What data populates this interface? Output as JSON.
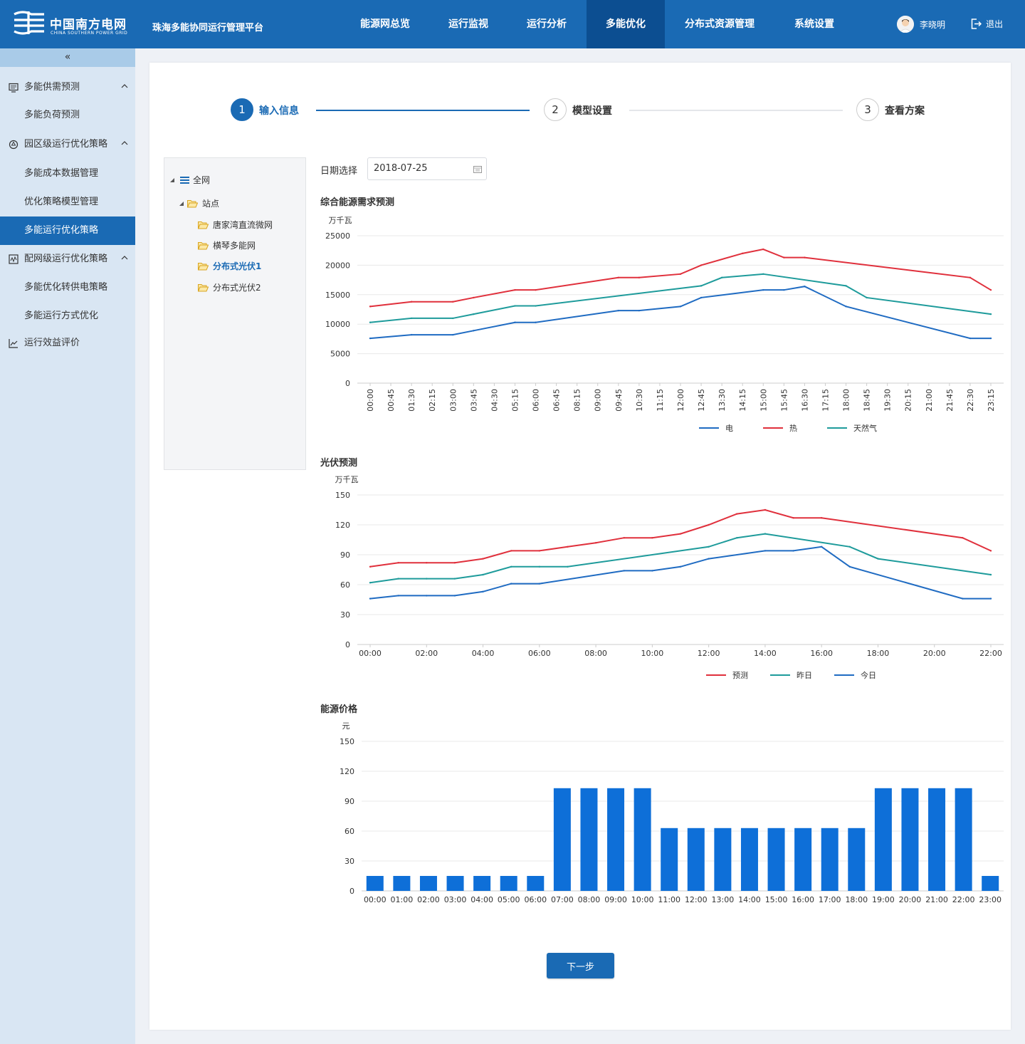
{
  "header": {
    "logo_cn": "中国南方电网",
    "logo_en": "CHINA SOUTHERN POWER GRID",
    "platform": "珠海多能协同运行管理平台",
    "nav": [
      "能源网总览",
      "运行监视",
      "运行分析",
      "多能优化",
      "分布式资源管理",
      "系统设置"
    ],
    "active_nav": "多能优化",
    "user_name": "李晓明",
    "logout": "退出"
  },
  "sidebar": {
    "collapse_icon": "«",
    "groups": [
      {
        "label": "多能供需预测",
        "icon": "monitor-icon",
        "expanded": true,
        "items": [
          "多能负荷预测"
        ]
      },
      {
        "label": "园区级运行优化策略",
        "icon": "recycle-icon",
        "expanded": true,
        "items": [
          "多能成本数据管理",
          "优化策略模型管理",
          "多能运行优化策略"
        ]
      },
      {
        "label": "配网级运行优化策略",
        "icon": "pulse-icon",
        "expanded": true,
        "items": [
          "多能优化转供电策略",
          "多能运行方式优化"
        ]
      },
      {
        "label": "运行效益评价",
        "icon": "line-chart-icon",
        "expanded": false,
        "items": []
      }
    ],
    "active_item": "多能运行优化策略"
  },
  "steps": [
    {
      "num": "1",
      "label": "输入信息",
      "status": "active"
    },
    {
      "num": "2",
      "label": "模型设置",
      "status": "todo"
    },
    {
      "num": "3",
      "label": "查看方案",
      "status": "todo"
    }
  ],
  "tree": {
    "root": "全网",
    "folder": "站点",
    "children": [
      "唐家湾直流微网",
      "横琴多能网",
      "分布式光伏1",
      "分布式光伏2"
    ],
    "selected": "分布式光伏1"
  },
  "date": {
    "label": "日期选择",
    "value": "2018-07-25"
  },
  "colors": {
    "primary": "#1a6ab4",
    "electric": "#1f6bc2",
    "heat": "#e0303c",
    "gas": "#1e9b9b",
    "bar": "#0e6fd8"
  },
  "chart_data": [
    {
      "type": "line",
      "title": "综合能源需求预测",
      "ylabel": "万千瓦",
      "ylim": [
        0,
        25000
      ],
      "yticks": [
        0,
        5000,
        10000,
        15000,
        20000,
        25000
      ],
      "x": [
        "00:00",
        "00:45",
        "01:30",
        "02:15",
        "03:00",
        "03:45",
        "04:30",
        "05:15",
        "06:00",
        "06:45",
        "08:15",
        "09:00",
        "09:45",
        "10:30",
        "11:15",
        "12:00",
        "12:45",
        "13:30",
        "14:15",
        "15:00",
        "15:45",
        "16:30",
        "17:15",
        "18:00",
        "18:45",
        "19:30",
        "20:15",
        "21:00",
        "21:45",
        "22:30",
        "23:15"
      ],
      "series": [
        {
          "name": "电",
          "color": "#1f6bc2",
          "values": [
            7600,
            null,
            8200,
            null,
            8200,
            8900,
            null,
            10300,
            10300,
            null,
            null,
            null,
            12300,
            12300,
            null,
            13000,
            14500,
            null,
            null,
            15800,
            15800,
            16400,
            null,
            13000,
            null,
            null,
            null,
            null,
            null,
            7600,
            7600
          ]
        },
        {
          "name": "热",
          "color": "#e0303c",
          "values": [
            13000,
            null,
            13800,
            null,
            13800,
            14500,
            null,
            15800,
            15800,
            null,
            null,
            null,
            17900,
            17900,
            null,
            18500,
            20000,
            null,
            22000,
            22700,
            21300,
            21300,
            null,
            null,
            null,
            null,
            null,
            null,
            null,
            17900,
            15800
          ]
        },
        {
          "name": "天然气",
          "color": "#1e9b9b",
          "values": [
            10300,
            null,
            11000,
            null,
            11000,
            11700,
            null,
            13100,
            13100,
            null,
            null,
            null,
            null,
            null,
            null,
            null,
            16500,
            17900,
            null,
            18500,
            null,
            null,
            null,
            16500,
            14500,
            null,
            null,
            null,
            null,
            null,
            11700
          ]
        }
      ],
      "legend_position": "bottom"
    },
    {
      "type": "line",
      "title": "光伏预测",
      "ylabel": "万千瓦",
      "ylim": [
        0,
        150
      ],
      "yticks": [
        0,
        30,
        60,
        90,
        120,
        150
      ],
      "x": [
        "00:00",
        "01:00",
        "02:00",
        "03:00",
        "04:00",
        "05:00",
        "06:00",
        "07:00",
        "08:00",
        "09:00",
        "10:00",
        "11:00",
        "12:00",
        "13:00",
        "14:00",
        "15:00",
        "16:00",
        "17:00",
        "18:00",
        "19:00",
        "20:00",
        "21:00",
        "22:00"
      ],
      "xtick_labels": [
        "00:00",
        "02:00",
        "04:00",
        "06:00",
        "08:00",
        "10:00",
        "12:00",
        "14:00",
        "16:00",
        "18:00",
        "20:00",
        "22:00"
      ],
      "series": [
        {
          "name": "预测",
          "color": "#e0303c",
          "values": [
            78,
            82,
            82,
            82,
            86,
            94,
            94,
            98,
            102,
            107,
            107,
            111,
            120,
            131,
            135,
            127,
            127,
            null,
            null,
            null,
            null,
            107,
            94
          ]
        },
        {
          "name": "昨日",
          "color": "#1e9b9b",
          "values": [
            62,
            66,
            66,
            66,
            70,
            78,
            78,
            78,
            null,
            null,
            null,
            null,
            98,
            107,
            111,
            null,
            null,
            98,
            86,
            null,
            null,
            null,
            70
          ]
        },
        {
          "name": "今日",
          "color": "#1f6bc2",
          "values": [
            46,
            49,
            49,
            49,
            53,
            61,
            61,
            null,
            null,
            74,
            74,
            78,
            86,
            null,
            94,
            94,
            98,
            78,
            null,
            null,
            null,
            46,
            46
          ]
        }
      ],
      "legend_position": "bottom"
    },
    {
      "type": "bar",
      "title": "能源价格",
      "ylabel": "元",
      "ylim": [
        0,
        150
      ],
      "yticks": [
        0,
        30,
        60,
        90,
        120,
        150
      ],
      "categories": [
        "00:00",
        "01:00",
        "02:00",
        "03:00",
        "04:00",
        "05:00",
        "06:00",
        "07:00",
        "08:00",
        "09:00",
        "10:00",
        "11:00",
        "12:00",
        "13:00",
        "14:00",
        "15:00",
        "16:00",
        "17:00",
        "18:00",
        "19:00",
        "20:00",
        "21:00",
        "22:00",
        "23:00"
      ],
      "values": [
        15,
        15,
        15,
        15,
        15,
        15,
        15,
        103,
        103,
        103,
        103,
        63,
        63,
        63,
        63,
        63,
        63,
        63,
        63,
        103,
        103,
        103,
        103,
        15
      ],
      "color": "#0e6fd8"
    }
  ],
  "buttons": {
    "next": "下一步"
  }
}
